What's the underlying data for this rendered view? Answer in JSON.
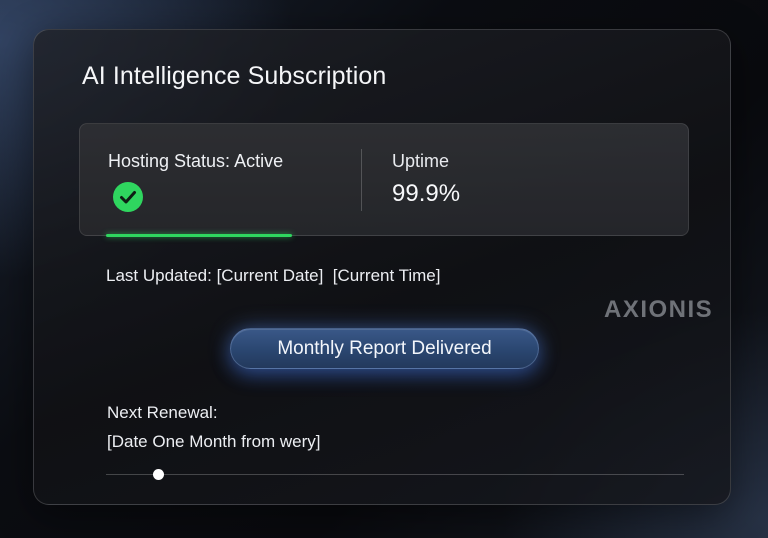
{
  "card": {
    "title": "AI Intelligence Subscription"
  },
  "status": {
    "hosting_label": "Hosting Status: Active",
    "status_icon": "check-circle-icon",
    "status_color": "#2fd65f",
    "uptime_label": "Uptime",
    "uptime_value": "99.9%",
    "progress_fraction": 0.33
  },
  "last_updated": {
    "text": "Last Updated: [Current Date]  [Current Time]"
  },
  "brand": {
    "logo_text": "AXIONIS"
  },
  "report": {
    "button_label": "Monthly Report Delivered",
    "accent_color": "#3a5888"
  },
  "renewal": {
    "label": "Next Renewal:",
    "date_text": "[Date One Month from wery]",
    "slider_fraction": 0.09
  }
}
